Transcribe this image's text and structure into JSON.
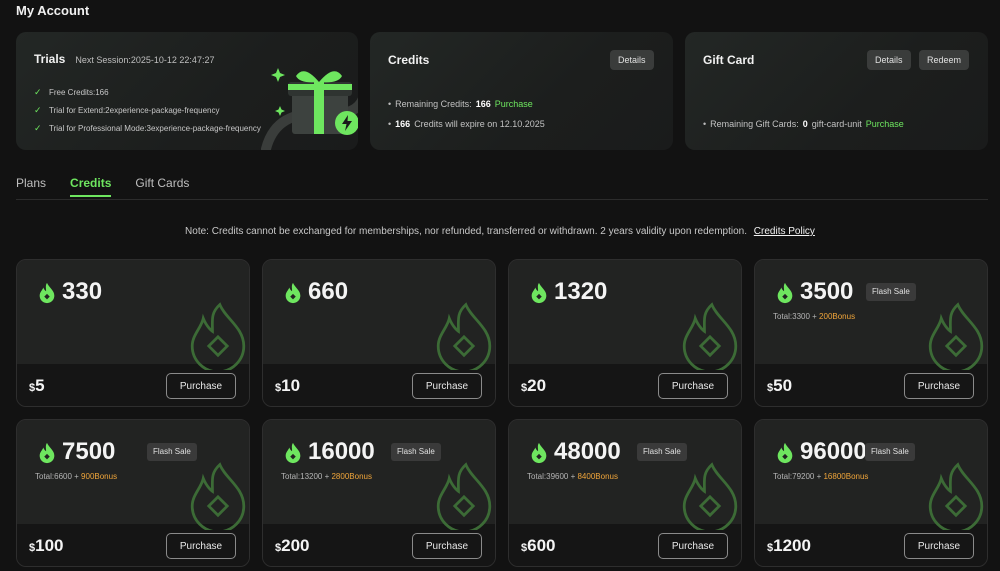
{
  "header": {
    "title": "My Account"
  },
  "trials": {
    "title": "Trials",
    "next_session": "Next Session:2025-10-12 22:47:27",
    "items": [
      "Free Credits:166",
      "Trial for Extend:2experience-package-frequency",
      "Trial for Professional Mode:3experience-package-frequency"
    ]
  },
  "credits_card": {
    "title": "Credits",
    "details_label": "Details",
    "remaining_label": "Remaining Credits:",
    "remaining_value": "166",
    "purchase_label": "Purchase",
    "expire_value": "166",
    "expire_text": "Credits will expire on 12.10.2025"
  },
  "gift_card": {
    "title": "Gift Card",
    "details_label": "Details",
    "redeem_label": "Redeem",
    "remaining_label": "Remaining Gift Cards:",
    "remaining_value": "0",
    "unit": "gift-card-unit",
    "purchase_label": "Purchase"
  },
  "tabs": [
    {
      "label": "Plans",
      "active": false
    },
    {
      "label": "Credits",
      "active": true
    },
    {
      "label": "Gift Cards",
      "active": false
    }
  ],
  "note": {
    "text": "Note: Credits cannot be exchanged for memberships, nor refunded, transferred or withdrawn. 2 years validity upon redemption.",
    "policy_label": "Credits Policy"
  },
  "currency_symbol": "$",
  "purchase_label": "Purchase",
  "flash_label": "Flash Sale",
  "packages": [
    {
      "amount": "330",
      "price": "5",
      "flash": false
    },
    {
      "amount": "660",
      "price": "10",
      "flash": false
    },
    {
      "amount": "1320",
      "price": "20",
      "flash": false
    },
    {
      "amount": "3500",
      "price": "50",
      "flash": true,
      "total": "Total:3300 + ",
      "bonus": "200Bonus"
    },
    {
      "amount": "7500",
      "price": "100",
      "flash": true,
      "total": "Total:6600 + ",
      "bonus": "900Bonus"
    },
    {
      "amount": "16000",
      "price": "200",
      "flash": true,
      "total": "Total:13200 + ",
      "bonus": "2800Bonus"
    },
    {
      "amount": "48000",
      "price": "600",
      "flash": true,
      "total": "Total:39600 + ",
      "bonus": "8400Bonus"
    },
    {
      "amount": "96000",
      "price": "1200",
      "flash": true,
      "total": "Total:79200 + ",
      "bonus": "16800Bonus"
    }
  ],
  "colors": {
    "accent": "#6ee65f",
    "bonus": "#f0a53a",
    "background": "#121212"
  },
  "icons": [
    "check-icon",
    "gift-icon",
    "flame-icon",
    "lightning-icon"
  ]
}
